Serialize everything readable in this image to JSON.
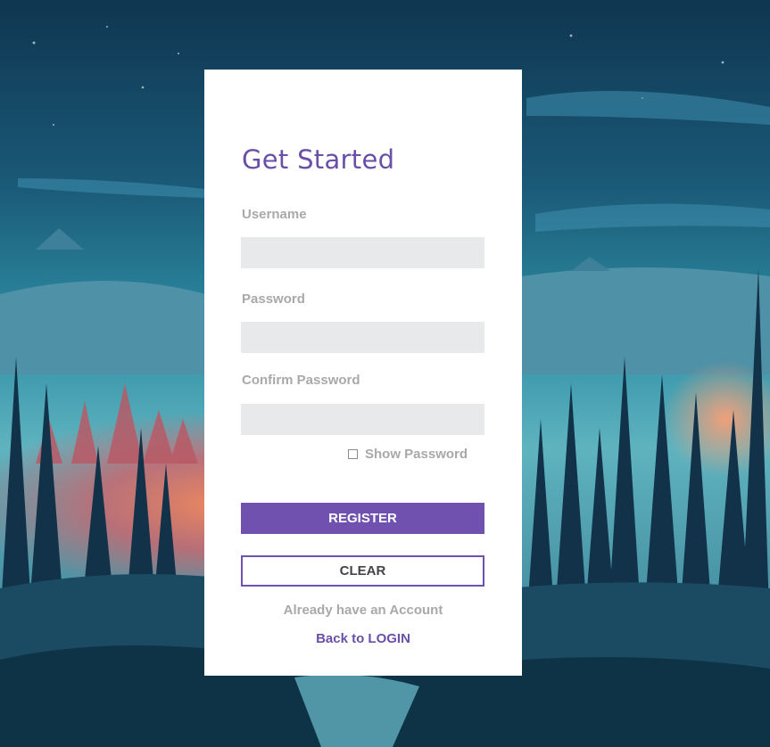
{
  "form": {
    "title": "Get Started",
    "username_label": "Username",
    "username_value": "",
    "password_label": "Password",
    "password_value": "",
    "confirm_label": "Confirm Password",
    "confirm_value": "",
    "show_password_label": "Show Password",
    "show_password_checked": false,
    "register_label": "REGISTER",
    "clear_label": "CLEAR",
    "already_text": "Already have an Account",
    "back_link": "Back to LOGIN"
  },
  "colors": {
    "accent": "#7051af",
    "title": "#6a4fa8",
    "label": "#a9a9a9",
    "field_bg": "#e8e9eb"
  }
}
